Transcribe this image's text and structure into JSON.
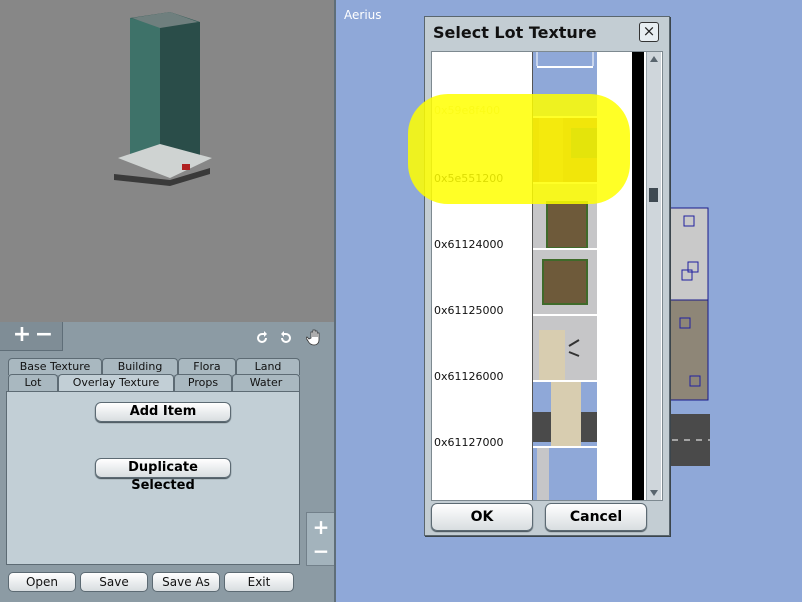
{
  "app": {
    "city_name": "Aerius"
  },
  "left_panel": {
    "zoom_in_symbol": "+",
    "zoom_out_symbol": "−",
    "tabs_row1": [
      "Base Texture",
      "Building",
      "Flora",
      "Land"
    ],
    "tabs_row2": [
      "Lot",
      "Overlay Texture",
      "Props",
      "Water"
    ],
    "active_tab": "Overlay Texture",
    "add_item_label": "Add Item",
    "duplicate_label": "Duplicate Selected",
    "bottom_buttons": [
      "Open",
      "Save",
      "Save As",
      "Exit"
    ]
  },
  "side_zoom": {
    "plus": "+",
    "minus": "−"
  },
  "dialog": {
    "title": "Select Lot Texture",
    "close_symbol": "×",
    "items": [
      "0x59e8f400",
      "0x5e551200",
      "0x61124000",
      "0x61125000",
      "0x61126000",
      "0x61127000"
    ],
    "ok_label": "OK",
    "cancel_label": "Cancel"
  },
  "colors": {
    "highlight": "#ffff00",
    "map_bg": "#8fa8d8",
    "panel_bg": "#8c9ba4"
  }
}
